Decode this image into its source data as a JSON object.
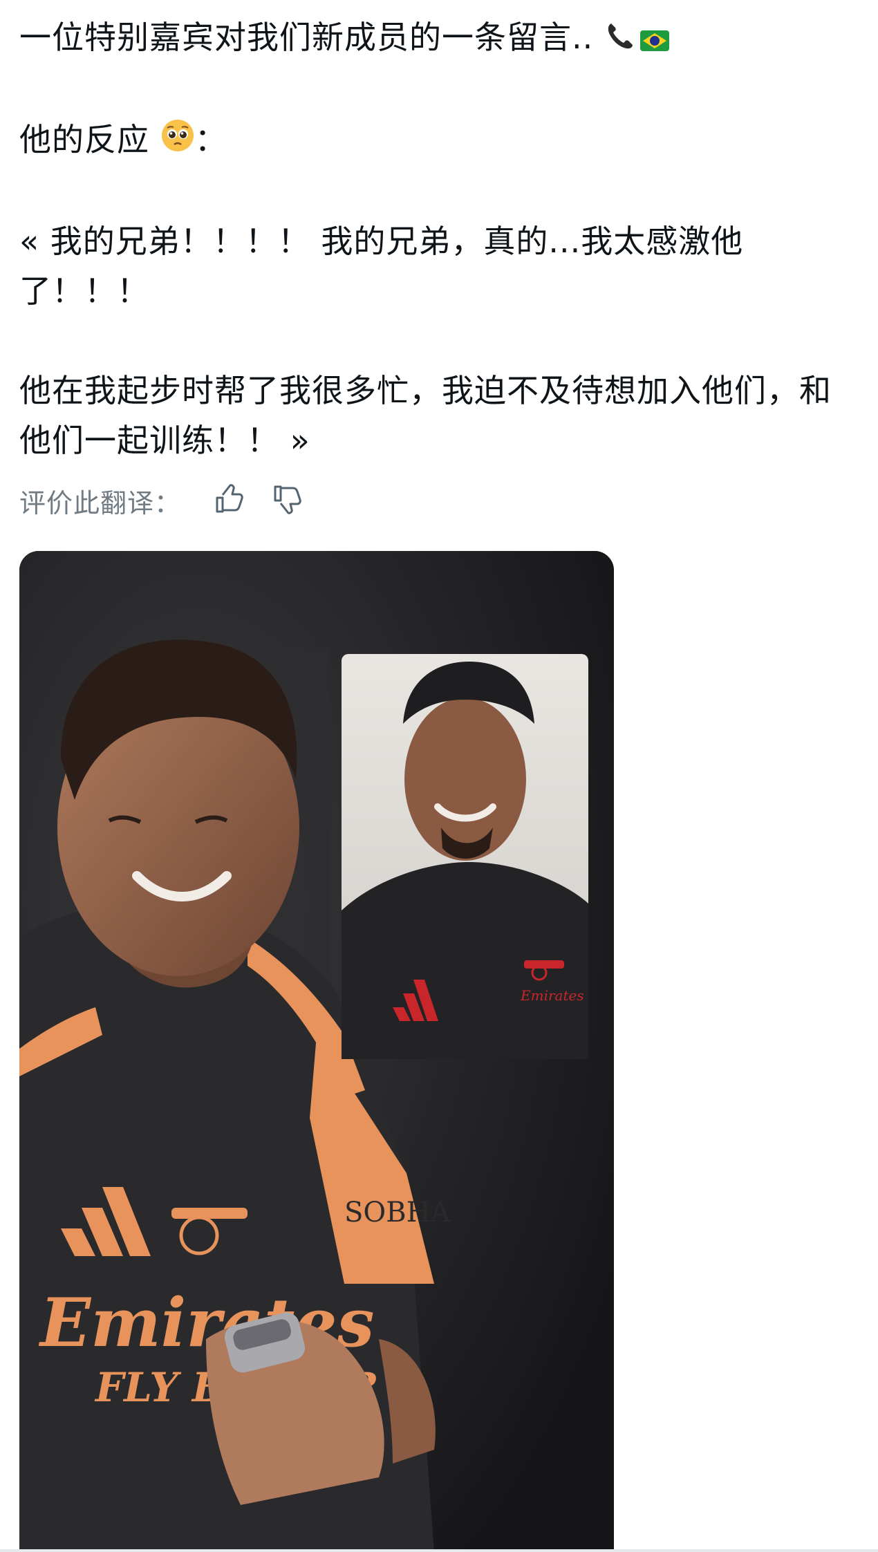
{
  "post": {
    "paragraphs": [
      {
        "text": "一位特别嘉宾对我们新成员的一条留言.. ",
        "emojis": [
          "telephone-receiver",
          "brazil-flag"
        ]
      },
      {
        "text": "他的反应 ",
        "emojis": [
          "pleading-face"
        ],
        "suffix": "："
      },
      {
        "text": "« 我的兄弟！！！！ 我的兄弟，真的...我太感激他了！！！"
      },
      {
        "text": "他在我起步时帮了我很多忙，我迫不及待想加入他们，和他们一起训练！！ »"
      }
    ]
  },
  "translation_feedback": {
    "label": "评价此翻译：",
    "thumbs_up_icon": "thumbs-up-icon",
    "thumbs_down_icon": "thumbs-down-icon"
  },
  "media": {
    "shirt_text": "Emirates",
    "shirt_subtext": "FLY BETTER",
    "sleeve_text": "SOBHA",
    "inset_shirt_text": "Emirates",
    "colors": {
      "background": "#1b1b1d",
      "kit_orange": "#e8935b",
      "kit_dark": "#2a2a2c",
      "inset_kit_red": "#c8262b"
    }
  }
}
